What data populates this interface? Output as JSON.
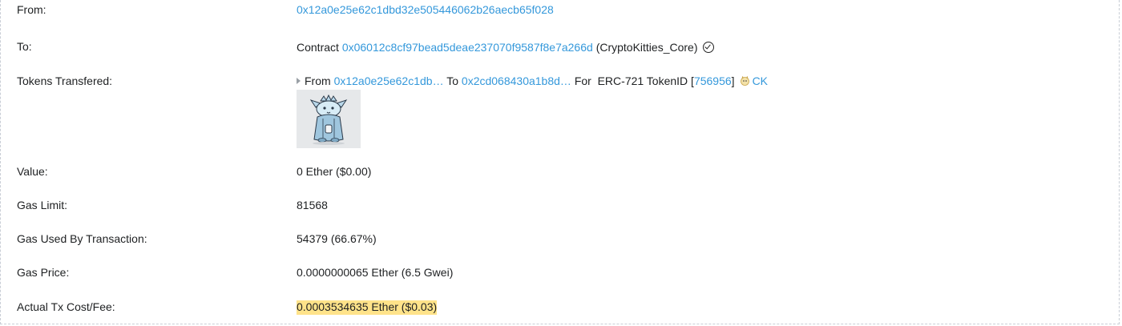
{
  "from": {
    "label": "From:",
    "address": "0x12a0e25e62c1dbd32e505446062b26aecb65f028"
  },
  "to": {
    "label": "To:",
    "prefix": "Contract",
    "address": "0x06012c8cf97bead5deae237070f9587f8e7a266d",
    "name": "(CryptoKitties_Core)"
  },
  "tokens": {
    "label": "Tokens Transfered:",
    "from_word": "From",
    "from_address": "0x12a0e25e62c1db…",
    "to_word": "To",
    "to_address": "0x2cd068430a1b8d…",
    "for_text": "For  ERC-721 TokenID [",
    "token_id": "756956",
    "close_bracket": "]",
    "token_symbol": "CK"
  },
  "value": {
    "label": "Value:",
    "text": "0 Ether ($0.00)"
  },
  "gas_limit": {
    "label": "Gas Limit:",
    "text": "81568"
  },
  "gas_used": {
    "label": "Gas Used By Transaction:",
    "text": "54379 (66.67%)"
  },
  "gas_price": {
    "label": "Gas Price:",
    "text": "0.0000000065 Ether (6.5 Gwei)"
  },
  "tx_fee": {
    "label": "Actual Tx Cost/Fee:",
    "text": "0.0003534635 Ether ($0.03)"
  },
  "colors": {
    "link": "#3498db",
    "highlight": "#ffe38a",
    "text": "#1e2022"
  }
}
